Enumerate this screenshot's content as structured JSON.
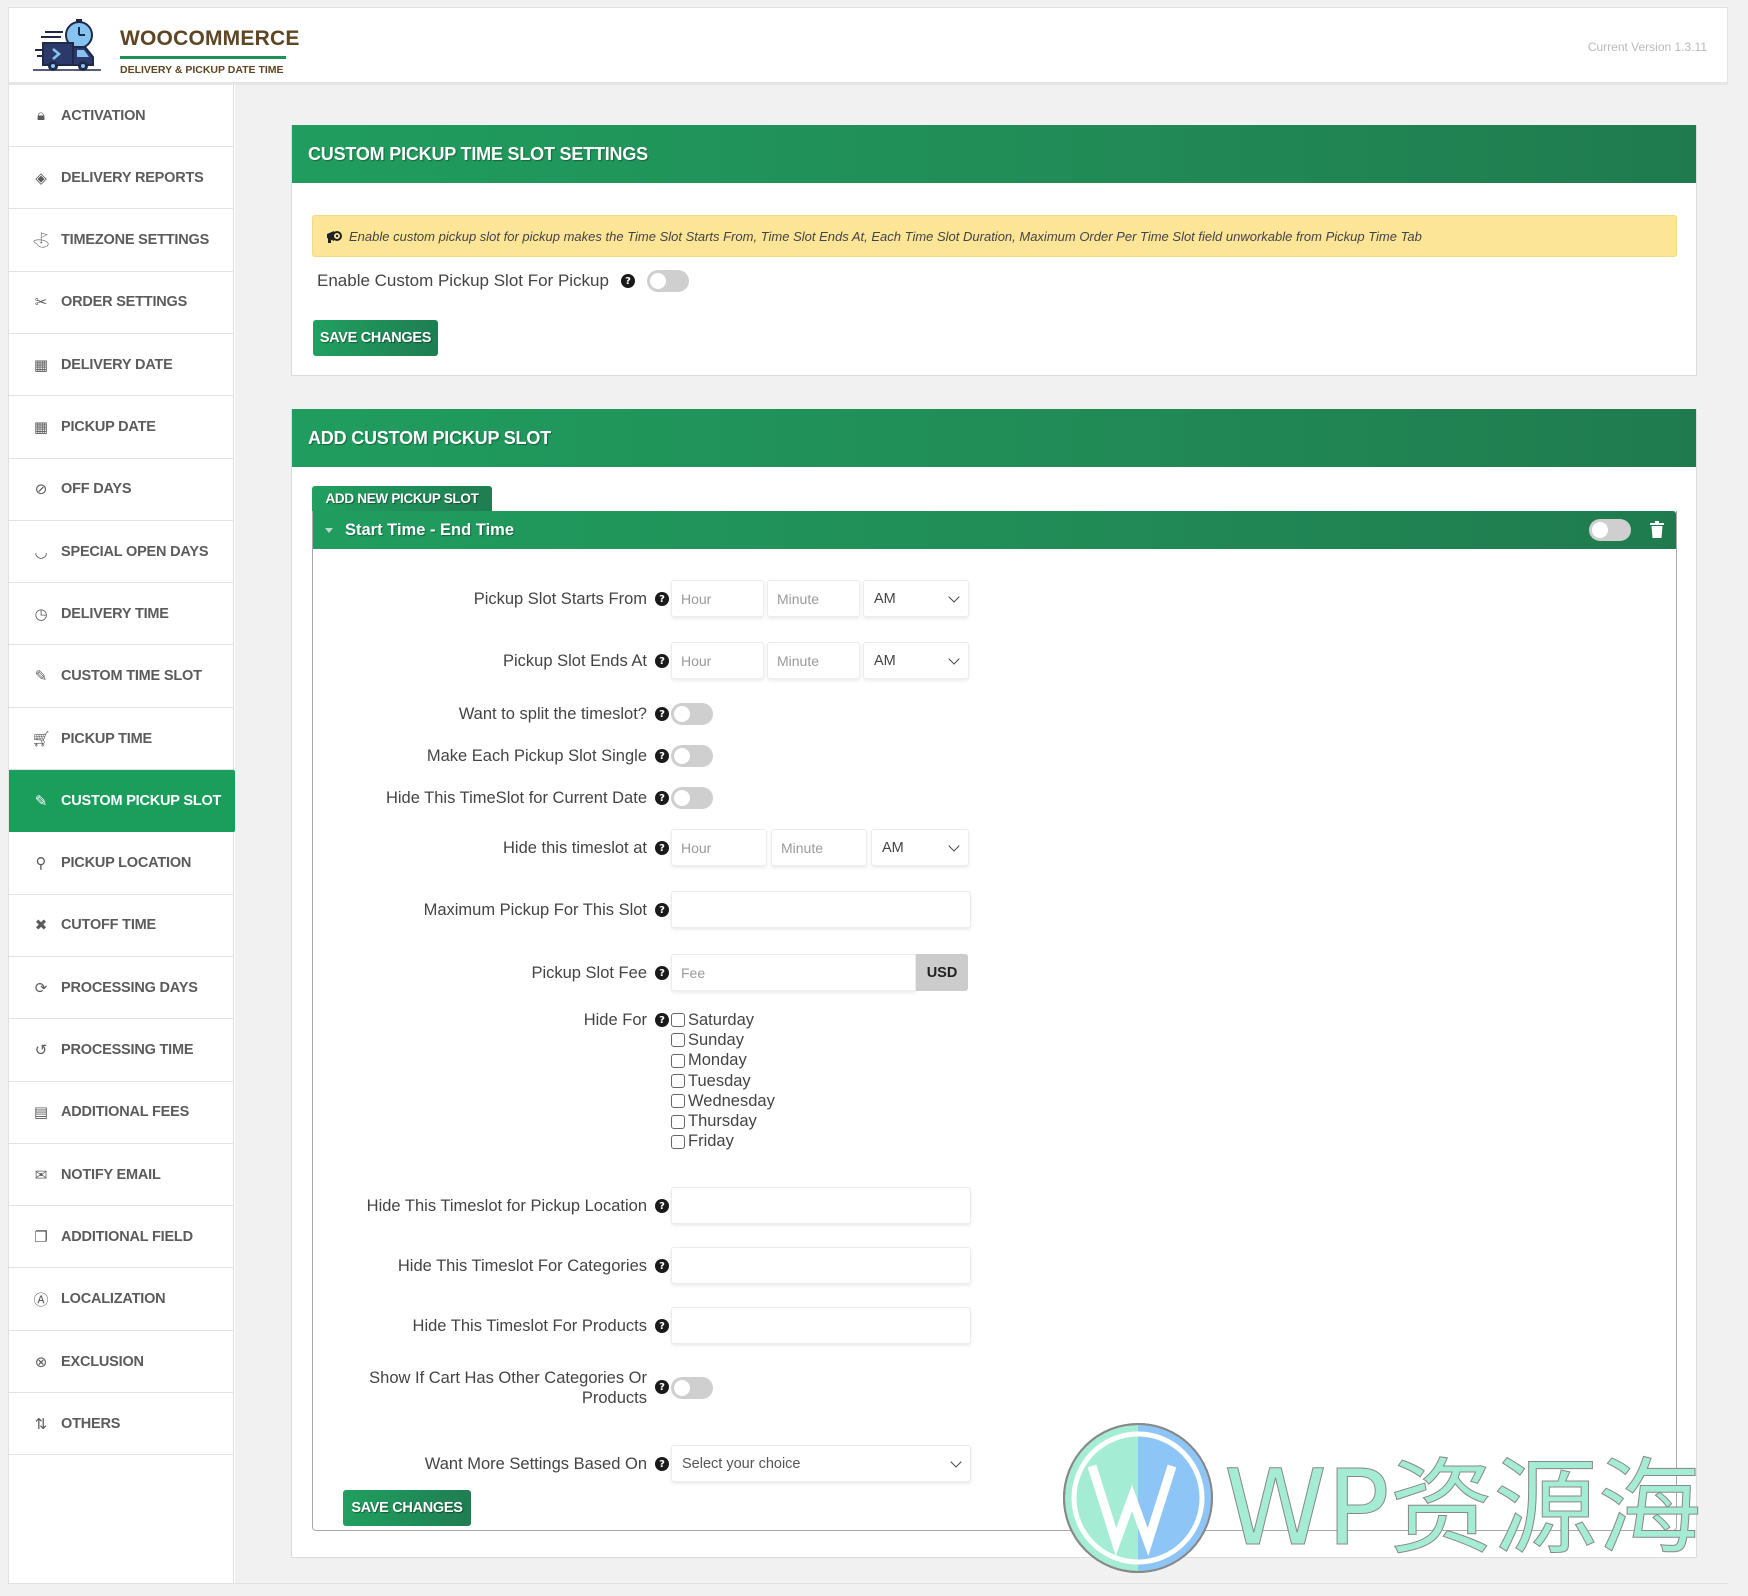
{
  "header": {
    "brand_title": "WOOCOMMERCE",
    "brand_subtitle": "DELIVERY & PICKUP DATE TIME",
    "logo_icon": "delivery-truck-clock-icon",
    "version": "Current Version 1.3.11"
  },
  "sidebar": {
    "active": "CUSTOM PICKUP SLOT",
    "items": [
      {
        "label": "ACTIVATION",
        "icon": "lock-icon"
      },
      {
        "label": "DELIVERY REPORTS",
        "icon": "tag-icon"
      },
      {
        "label": "TIMEZONE SETTINGS",
        "icon": "map-pin-icon"
      },
      {
        "label": "ORDER SETTINGS",
        "icon": "plug-icon"
      },
      {
        "label": "DELIVERY DATE",
        "icon": "calendar-icon"
      },
      {
        "label": "PICKUP DATE",
        "icon": "calendar-icon"
      },
      {
        "label": "OFF DAYS",
        "icon": "eye-slash-icon"
      },
      {
        "label": "SPECIAL OPEN DAYS",
        "icon": "smile-icon"
      },
      {
        "label": "DELIVERY TIME",
        "icon": "clock-icon"
      },
      {
        "label": "CUSTOM TIME SLOT",
        "icon": "edit-icon"
      },
      {
        "label": "PICKUP TIME",
        "icon": "cart-icon"
      },
      {
        "label": "CUSTOM PICKUP SLOT",
        "icon": "edit-icon"
      },
      {
        "label": "PICKUP LOCATION",
        "icon": "location-pin-icon"
      },
      {
        "label": "CUTOFF TIME",
        "icon": "comment-x-icon"
      },
      {
        "label": "PROCESSING DAYS",
        "icon": "refresh-icon"
      },
      {
        "label": "PROCESSING TIME",
        "icon": "history-icon"
      },
      {
        "label": "ADDITIONAL FEES",
        "icon": "images-icon"
      },
      {
        "label": "NOTIFY EMAIL",
        "icon": "envelope-icon"
      },
      {
        "label": "ADDITIONAL FIELD",
        "icon": "copy-icon"
      },
      {
        "label": "LOCALIZATION",
        "icon": "translate-icon"
      },
      {
        "label": "EXCLUSION",
        "icon": "circle-x-icon"
      },
      {
        "label": "OTHERS",
        "icon": "sort-icon"
      }
    ]
  },
  "settings_panel": {
    "title": "CUSTOM PICKUP TIME SLOT SETTINGS",
    "notice": "Enable custom pickup slot for pickup makes the Time Slot Starts From, Time Slot Ends At, Each Time Slot Duration, Maximum Order Per Time Slot field unworkable from Pickup Time Tab",
    "enable_label": "Enable Custom Pickup Slot For Pickup",
    "enable_value": false,
    "save_label": "SAVE CHANGES"
  },
  "add_panel": {
    "title": "ADD CUSTOM PICKUP SLOT",
    "add_button": "ADD NEW PICKUP SLOT",
    "slot": {
      "title": "Start Time - End Time",
      "enabled": false,
      "fields": {
        "starts_from": {
          "label": "Pickup Slot Starts From",
          "hour_placeholder": "Hour",
          "minute_placeholder": "Minute",
          "ampm": "AM"
        },
        "ends_at": {
          "label": "Pickup Slot Ends At",
          "hour_placeholder": "Hour",
          "minute_placeholder": "Minute",
          "ampm": "AM"
        },
        "split": {
          "label": "Want to split the timeslot?",
          "value": false
        },
        "single": {
          "label": "Make Each Pickup Slot Single",
          "value": false
        },
        "hide_current": {
          "label": "Hide This TimeSlot for Current Date",
          "value": false
        },
        "hide_at": {
          "label": "Hide this timeslot at",
          "hour_placeholder": "Hour",
          "minute_placeholder": "Minute",
          "ampm": "AM"
        },
        "max_pickup": {
          "label": "Maximum Pickup For This Slot",
          "value": ""
        },
        "fee": {
          "label": "Pickup Slot Fee",
          "placeholder": "Fee",
          "currency": "USD"
        },
        "hide_for": {
          "label": "Hide For",
          "days": [
            {
              "label": "Saturday",
              "checked": false
            },
            {
              "label": "Sunday",
              "checked": false
            },
            {
              "label": "Monday",
              "checked": false
            },
            {
              "label": "Tuesday",
              "checked": false
            },
            {
              "label": "Wednesday",
              "checked": false
            },
            {
              "label": "Thursday",
              "checked": false
            },
            {
              "label": "Friday",
              "checked": false
            }
          ]
        },
        "hide_location": {
          "label": "Hide This Timeslot for Pickup Location",
          "value": ""
        },
        "hide_categories": {
          "label": "Hide This Timeslot For Categories",
          "value": ""
        },
        "hide_products": {
          "label": "Hide This Timeslot For Products",
          "value": ""
        },
        "show_if_cart": {
          "label_line1": "Show If Cart Has Other Categories Or",
          "label_line2": "Products",
          "value": false
        },
        "more_settings": {
          "label": "Want More Settings Based On",
          "selected": "Select your choice"
        }
      }
    },
    "save_label": "SAVE CHANGES"
  },
  "watermark": {
    "text": "WP资源海"
  },
  "colors": {
    "brand_green": "#1b9d5c",
    "brand_brown": "#5e4523",
    "notice_yellow": "#fde598"
  }
}
